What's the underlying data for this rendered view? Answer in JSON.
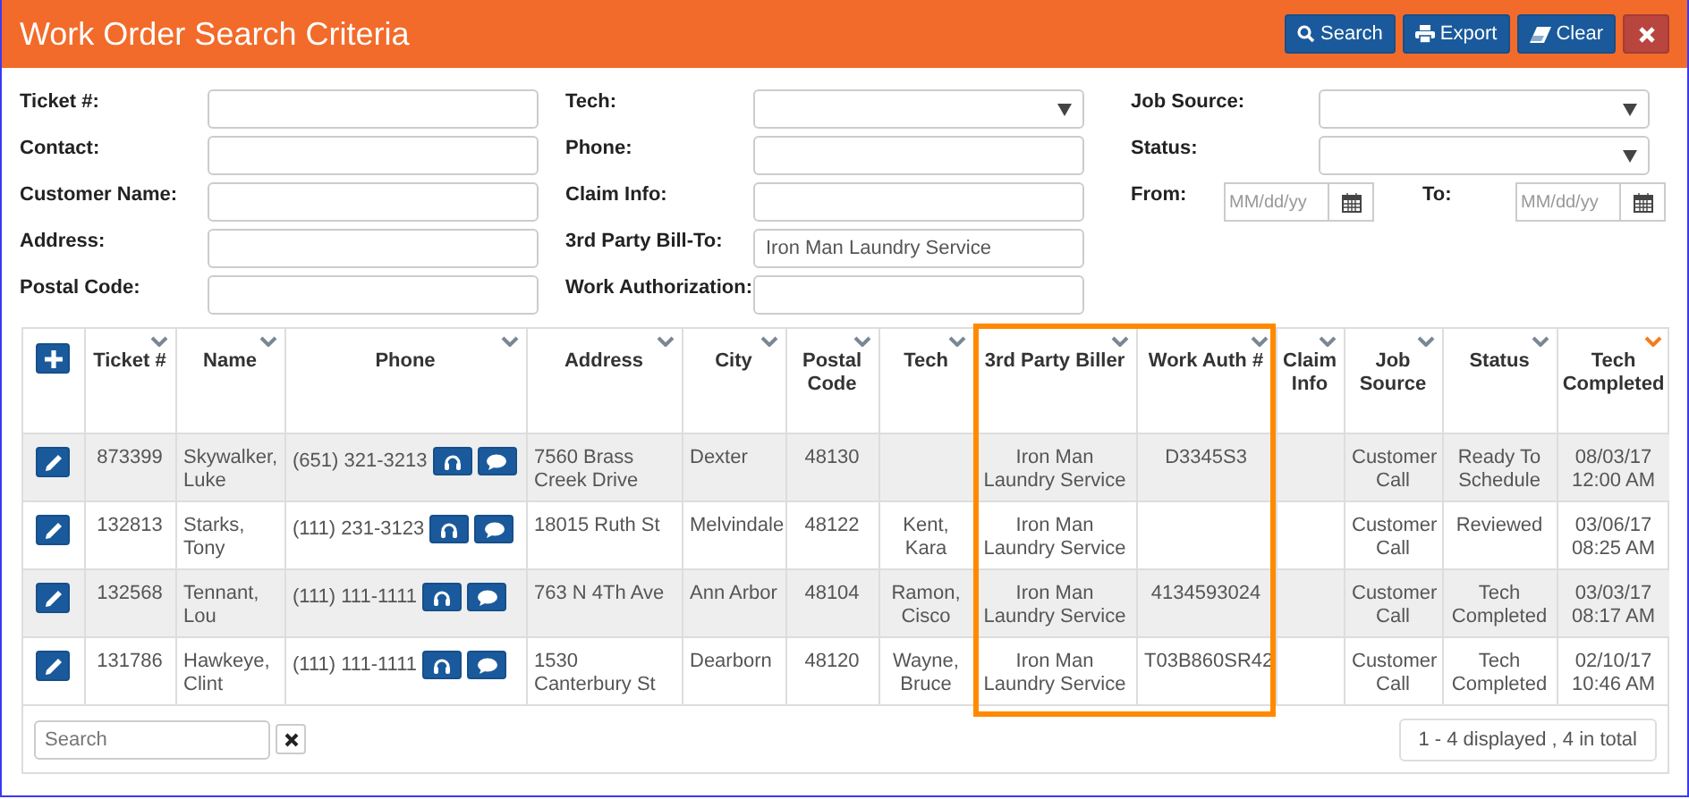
{
  "header": {
    "title": "Work Order Search Criteria",
    "buttons": [
      {
        "kind": "search",
        "label": "Search"
      },
      {
        "kind": "export",
        "label": "Export"
      },
      {
        "kind": "clear",
        "label": "Clear"
      },
      {
        "kind": "close"
      }
    ]
  },
  "form": {
    "columns": [
      [
        {
          "kind": "text",
          "label": "Ticket #:"
        },
        {
          "kind": "text",
          "label": "Contact:"
        },
        {
          "kind": "text",
          "label": "Customer Name:"
        },
        {
          "kind": "text",
          "label": "Address:"
        },
        {
          "kind": "text",
          "label": "Postal Code:"
        }
      ],
      [
        {
          "kind": "select",
          "label": "Tech:"
        },
        {
          "kind": "text",
          "label": "Phone:"
        },
        {
          "kind": "text",
          "label": "Claim Info:"
        },
        {
          "kind": "text",
          "label": "3rd Party Bill-To:",
          "value": "Iron Man Laundry Service"
        },
        {
          "kind": "text",
          "label": "Work Authorization:"
        }
      ],
      [
        {
          "kind": "select",
          "label": "Job Source:"
        },
        {
          "kind": "select",
          "label": "Status:"
        },
        {
          "kind": "daterange",
          "from": {
            "label": "From:",
            "placeholder": "MM/dd/yy"
          },
          "to": {
            "label": "To:",
            "placeholder": "MM/dd/yy"
          }
        }
      ]
    ]
  },
  "table": {
    "columns": [
      {
        "kind": "add"
      },
      {
        "label": "Ticket #",
        "sorted": false,
        "highlighted": false
      },
      {
        "label": "Name",
        "sorted": false,
        "highlighted": false
      },
      {
        "label": "Phone",
        "sorted": false,
        "highlighted": false
      },
      {
        "label": "Address",
        "sorted": false,
        "highlighted": false
      },
      {
        "label": "City",
        "sorted": false,
        "highlighted": false
      },
      {
        "label": "Postal Code",
        "sorted": false,
        "highlighted": false
      },
      {
        "label": "Tech",
        "sorted": false,
        "highlighted": false
      },
      {
        "label": "3rd Party Biller",
        "sorted": false,
        "highlighted": true
      },
      {
        "label": "Work Auth #",
        "sorted": false,
        "highlighted": true
      },
      {
        "label": "Claim Info",
        "sorted": false,
        "highlighted": false
      },
      {
        "label": "Job Source",
        "sorted": false,
        "highlighted": false
      },
      {
        "label": "Status",
        "sorted": false,
        "highlighted": false
      },
      {
        "label": "Tech Completed",
        "sorted": true,
        "highlighted": false
      }
    ],
    "rows": [
      {
        "ticket": "873399",
        "name": "Skywalker, Luke",
        "phone": "(651) 321-3213",
        "address": "7560 Brass Creek Drive",
        "city": "Dexter",
        "postal_code": "48130",
        "biller": "Iron Man Laundry Service",
        "work_auth": "D3345S3",
        "job_source": "Customer Call",
        "status": "Ready To Schedule",
        "tech_completed": "08/03/17 12:00 AM"
      },
      {
        "ticket": "132813",
        "name": "Starks, Tony",
        "phone": "(111) 231-3123",
        "address": "18015 Ruth St",
        "city": "Melvindale",
        "postal_code": "48122",
        "tech": "Kent, Kara",
        "biller": "Iron Man Laundry Service",
        "job_source": "Customer Call",
        "status": "Reviewed",
        "tech_completed": "03/06/17 08:25 AM"
      },
      {
        "ticket": "132568",
        "name": "Tennant, Lou",
        "phone": "(111) 111-1111",
        "address": "763 N 4Th Ave",
        "city": "Ann Arbor",
        "postal_code": "48104",
        "tech": "Ramon, Cisco",
        "biller": "Iron Man Laundry Service",
        "work_auth": "4134593024",
        "job_source": "Customer Call",
        "status": "Tech Completed",
        "tech_completed": "03/03/17 08:17 AM"
      },
      {
        "ticket": "131786",
        "name": "Hawkeye, Clint",
        "phone": "(111) 111-1111",
        "address": "1530 Canterbury St",
        "city": "Dearborn",
        "postal_code": "48120",
        "tech": "Wayne, Bruce",
        "biller": "Iron Man Laundry Service",
        "work_auth": "T03B860SR42",
        "job_source": "Customer Call",
        "status": "Tech Completed",
        "tech_completed": "02/10/17 10:46 AM"
      }
    ]
  },
  "footer": {
    "search": {
      "placeholder": "Search"
    },
    "pager": "1 - 4 displayed , 4 in total"
  }
}
